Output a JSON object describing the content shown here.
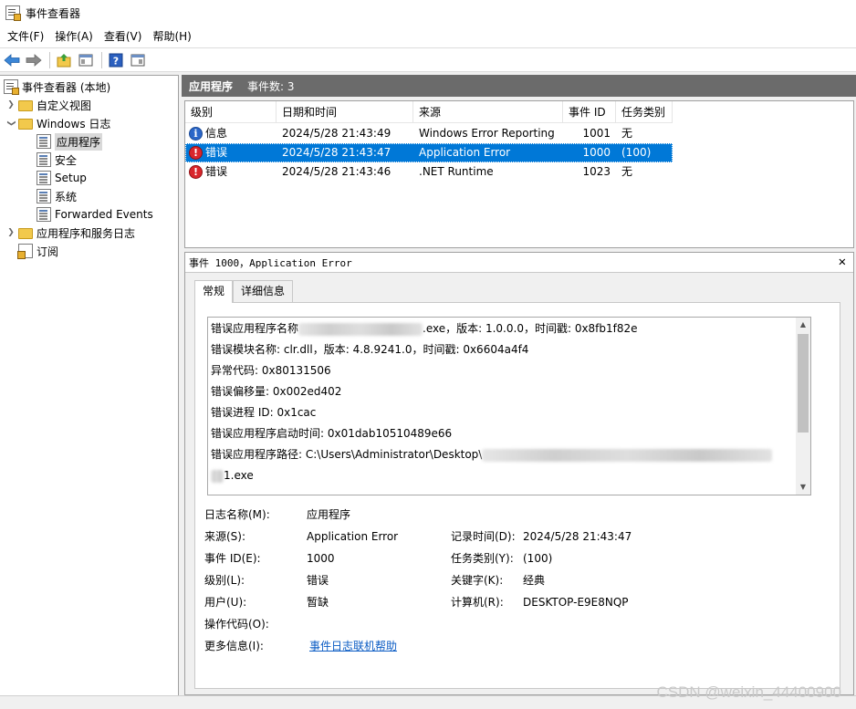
{
  "window": {
    "title": "事件查看器"
  },
  "menu": [
    "文件(F)",
    "操作(A)",
    "查看(V)",
    "帮助(H)"
  ],
  "toolbar": {
    "icons": [
      "back-arrow-icon",
      "forward-arrow-icon",
      "folder-up-icon",
      "console-tree-icon",
      "help-icon",
      "action-pane-icon"
    ]
  },
  "tree": {
    "root": "事件查看器 (本地)",
    "custom_views": "自定义视图",
    "windows_logs": "Windows 日志",
    "logs": [
      "应用程序",
      "安全",
      "Setup",
      "系统",
      "Forwarded Events"
    ],
    "app_service_logs": "应用程序和服务日志",
    "subscriptions": "订阅"
  },
  "main": {
    "title": "应用程序",
    "count_label": "事件数: 3"
  },
  "list": {
    "columns": [
      "级别",
      "日期和时间",
      "来源",
      "事件 ID",
      "任务类别"
    ],
    "rows": [
      {
        "level": "信息",
        "level_icon": "info-icon",
        "datetime": "2024/5/28 21:43:49",
        "source": "Windows Error Reporting",
        "id": "1001",
        "category": "无"
      },
      {
        "level": "错误",
        "level_icon": "error-icon",
        "datetime": "2024/5/28 21:43:47",
        "source": "Application Error",
        "id": "1000",
        "category": "(100)"
      },
      {
        "level": "错误",
        "level_icon": "error-icon",
        "datetime": "2024/5/28 21:43:46",
        "source": ".NET Runtime",
        "id": "1023",
        "category": "无"
      }
    ]
  },
  "detail": {
    "title": "事件 1000，Application Error",
    "tabs": [
      "常规",
      "详细信息"
    ],
    "description_lines": [
      {
        "prefix": "错误应用程序名称",
        "suffix": ".exe，版本: 1.0.0.0，时间戳: 0x8fb1f82e"
      },
      {
        "text": "错误模块名称: clr.dll，版本: 4.8.9241.0，时间戳: 0x6604a4f4"
      },
      {
        "text": "异常代码: 0x80131506"
      },
      {
        "text": "错误偏移量: 0x002ed402"
      },
      {
        "text": "错误进程 ID: 0x1cac"
      },
      {
        "text": "错误应用程序启动时间: 0x01dab10510489e66"
      },
      {
        "prefix": "错误应用程序路径: C:\\Users\\Administrator\\Desktop\\"
      },
      {
        "suffix": "1.exe"
      }
    ],
    "fields": {
      "log_name_label": "日志名称(M):",
      "log_name": "应用程序",
      "source_label": "来源(S):",
      "source": "Application Error",
      "logged_label": "记录时间(D):",
      "logged": "2024/5/28 21:43:47",
      "event_id_label": "事件 ID(E):",
      "event_id": "1000",
      "task_label": "任务类别(Y):",
      "task": "(100)",
      "level_label": "级别(L):",
      "level": "错误",
      "keywords_label": "关键字(K):",
      "keywords": "经典",
      "user_label": "用户(U):",
      "user": "暂缺",
      "computer_label": "计算机(R):",
      "computer": "DESKTOP-E9E8NQP",
      "opcode_label": "操作代码(O):",
      "more_info_label": "更多信息(I):",
      "more_info_link": "事件日志联机帮助"
    }
  },
  "watermark": "CSDN @weixin_44400900"
}
